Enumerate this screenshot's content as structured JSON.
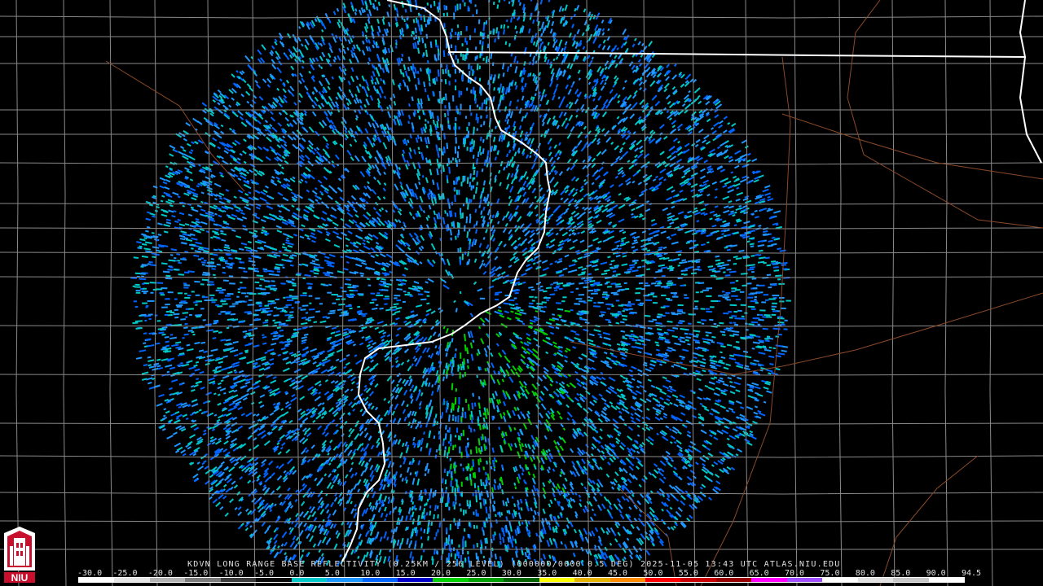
{
  "product_label": "KDVN LONG RANGE BASE REFLECTIVITY (0.25KM / 256 LEVEL) (000000/0000 0.5 DEG) 2025-11-05 13:43 UTC  ATLAS.NIU.EDU",
  "scale": {
    "ticks": [
      "-30.0",
      "-25.0",
      "-20.0",
      "-15.0",
      "-10.0",
      "-5.0",
      "0.0",
      "5.0",
      "10.0",
      "15.0",
      "20.0",
      "25.0",
      "30.0",
      "35.0",
      "40.0",
      "45.0",
      "50.0",
      "55.0",
      "60.0",
      "65.0",
      "70.0",
      "75.0",
      "80.0",
      "85.0",
      "90.0",
      "94.5"
    ],
    "colors": [
      "#ffffff",
      "#e6e6e6",
      "#b4b4b4",
      "#7c7c7c",
      "#3c3c3c",
      "#0a0a0a",
      "#00c8c8",
      "#1e96ff",
      "#0064ff",
      "#0000c8",
      "#00d000",
      "#00a000",
      "#006400",
      "#ffff00",
      "#e6b400",
      "#ff8c00",
      "#ff0000",
      "#c80000",
      "#960000",
      "#ff00ff",
      "#a050ff",
      "#ffffff",
      "#e0e0e0",
      "#c8c8c8",
      "#ffffff"
    ]
  },
  "logo": {
    "text": "NIU",
    "icon": "university-tower-icon"
  },
  "map": {
    "radar_site": "KDVN",
    "colors": {
      "background": "#000000",
      "county_lines": "#8a8a8a",
      "state_lines": "#ffffff",
      "highways": "#8b4a2a"
    }
  }
}
